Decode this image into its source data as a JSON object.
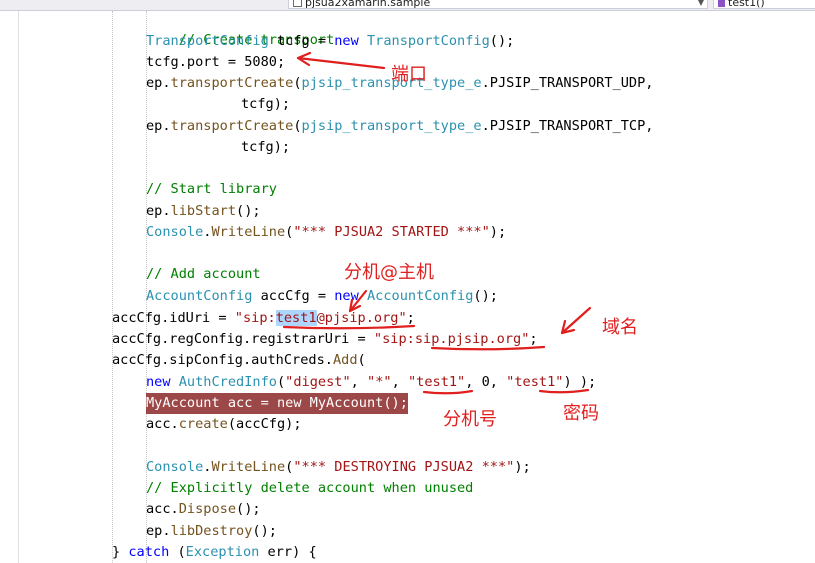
{
  "toolbar": {
    "project_dropdown": "pjsua2xamarin.sample",
    "member_dropdown": "test1()"
  },
  "code": {
    "line1": {
      "comment": "// Create transport"
    },
    "line2": {
      "type1": "TransportConfig",
      "var": " tcfg = ",
      "kw": "new",
      "type2": " TransportConfig",
      "rest": "();"
    },
    "line3": {
      "text": "tcfg.port = 5080;"
    },
    "line4": {
      "obj": "ep.",
      "method": "transportCreate",
      "paren": "(",
      "type": "pjsip_transport_type_e",
      "rest": ".PJSIP_TRANSPORT_UDP,"
    },
    "line5": {
      "text": "tcfg);"
    },
    "line6": {
      "obj": "ep.",
      "method": "transportCreate",
      "paren": "(",
      "type": "pjsip_transport_type_e",
      "rest": ".PJSIP_TRANSPORT_TCP,"
    },
    "line7": {
      "text": "tcfg);"
    },
    "line8": {
      "comment": "// Start library"
    },
    "line9": {
      "obj": "ep.",
      "method": "libStart",
      "rest": "();"
    },
    "line10": {
      "type": "Console",
      "dot": ".",
      "method": "WriteLine",
      "paren": "(",
      "string": "\"*** PJSUA2 STARTED ***\"",
      "rest": ");"
    },
    "line11": {
      "comment": "// Add account"
    },
    "line12": {
      "type1": "AccountConfig",
      "var": " accCfg = ",
      "kw": "new",
      "type2": " AccountConfig",
      "rest": "();"
    },
    "line13": {
      "pre": "accCfg.idUri = ",
      "str1": "\"sip:",
      "sel": "test1",
      "str2": "@pjsip.org\"",
      "rest": ";"
    },
    "line14": {
      "pre": "accCfg.regConfig.registrarUri = ",
      "str": "\"sip:sip.pjsip.org\"",
      "rest": ";"
    },
    "line15": {
      "pre": "accCfg.sipConfig.authCreds.",
      "method": "Add",
      "rest": "("
    },
    "line16": {
      "kw": "new",
      "type": " AuthCredInfo",
      "paren": "(",
      "s1": "\"digest\"",
      "c1": ", ",
      "s2": "\"*\"",
      "c2": ", ",
      "s3": "\"test1\"",
      "c3": ", 0, ",
      "s4": "\"test1\"",
      "rest": ") );"
    },
    "line17": {
      "text": "MyAccount acc = new MyAccount();"
    },
    "line18": {
      "obj": "acc.",
      "method": "create",
      "rest": "(accCfg);"
    },
    "line19": {
      "type": "Console",
      "dot": ".",
      "method": "WriteLine",
      "paren": "(",
      "string": "\"*** DESTROYING PJSUA2 ***\"",
      "rest": ");"
    },
    "line20": {
      "comment": "// Explicitly delete account when unused"
    },
    "line21": {
      "obj": "acc.",
      "method": "Dispose",
      "rest": "();"
    },
    "line22": {
      "obj": "ep.",
      "method": "libDestroy",
      "rest": "();"
    },
    "line23": {
      "brace": "} ",
      "kw": "catch",
      "paren": " (",
      "type": "Exception",
      "rest": " err) {"
    }
  },
  "annotations": {
    "port": "端口",
    "ext_host": "分机@主机",
    "domain": "域名",
    "ext_number": "分机号",
    "password": "密码",
    "color": "#e01f1f"
  }
}
